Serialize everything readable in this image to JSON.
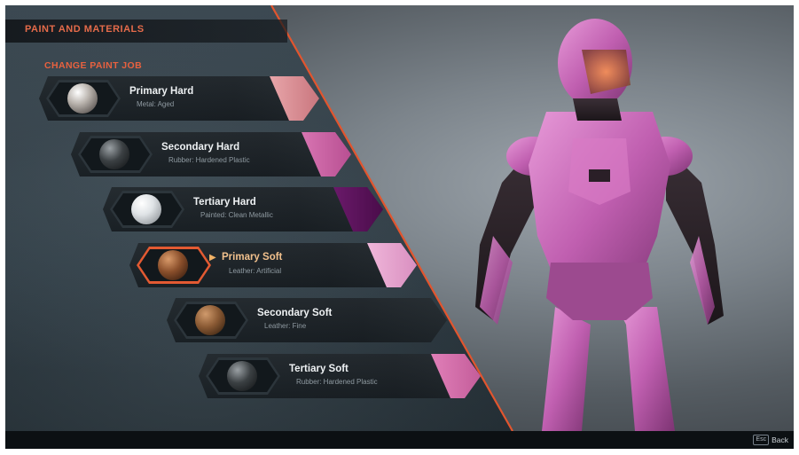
{
  "header": {
    "title": "PAINT AND MATERIALS"
  },
  "section": {
    "title": "CHANGE PAINT JOB"
  },
  "slots": [
    {
      "name": "Primary Hard",
      "material": "Metal: Aged",
      "swatch_color": "#d48e95",
      "ball": "silver",
      "selected": false
    },
    {
      "name": "Secondary Hard",
      "material": "Rubber: Hardened Plastic",
      "swatch_color": "#c85f9f",
      "ball": "dark-gray",
      "selected": false
    },
    {
      "name": "Tertiary Hard",
      "material": "Painted: Clean Metallic",
      "swatch_color": "#5a0f5a",
      "ball": "white",
      "selected": false
    },
    {
      "name": "Primary Soft",
      "material": "Leather: Artificial",
      "swatch_color": "#e6a6d0",
      "ball": "brown",
      "selected": true
    },
    {
      "name": "Secondary Soft",
      "material": "Leather: Fine",
      "swatch_color": "none",
      "ball": "brown",
      "selected": false
    },
    {
      "name": "Tertiary Soft",
      "material": "Rubber: Hardened Plastic",
      "swatch_color": "#d66ea9",
      "ball": "dark-gray",
      "selected": false
    }
  ],
  "footer": {
    "key": "Esc",
    "back_label": "Back"
  },
  "colors": {
    "accent": "#e56b4a",
    "armor_pink": "#c05fb0"
  }
}
